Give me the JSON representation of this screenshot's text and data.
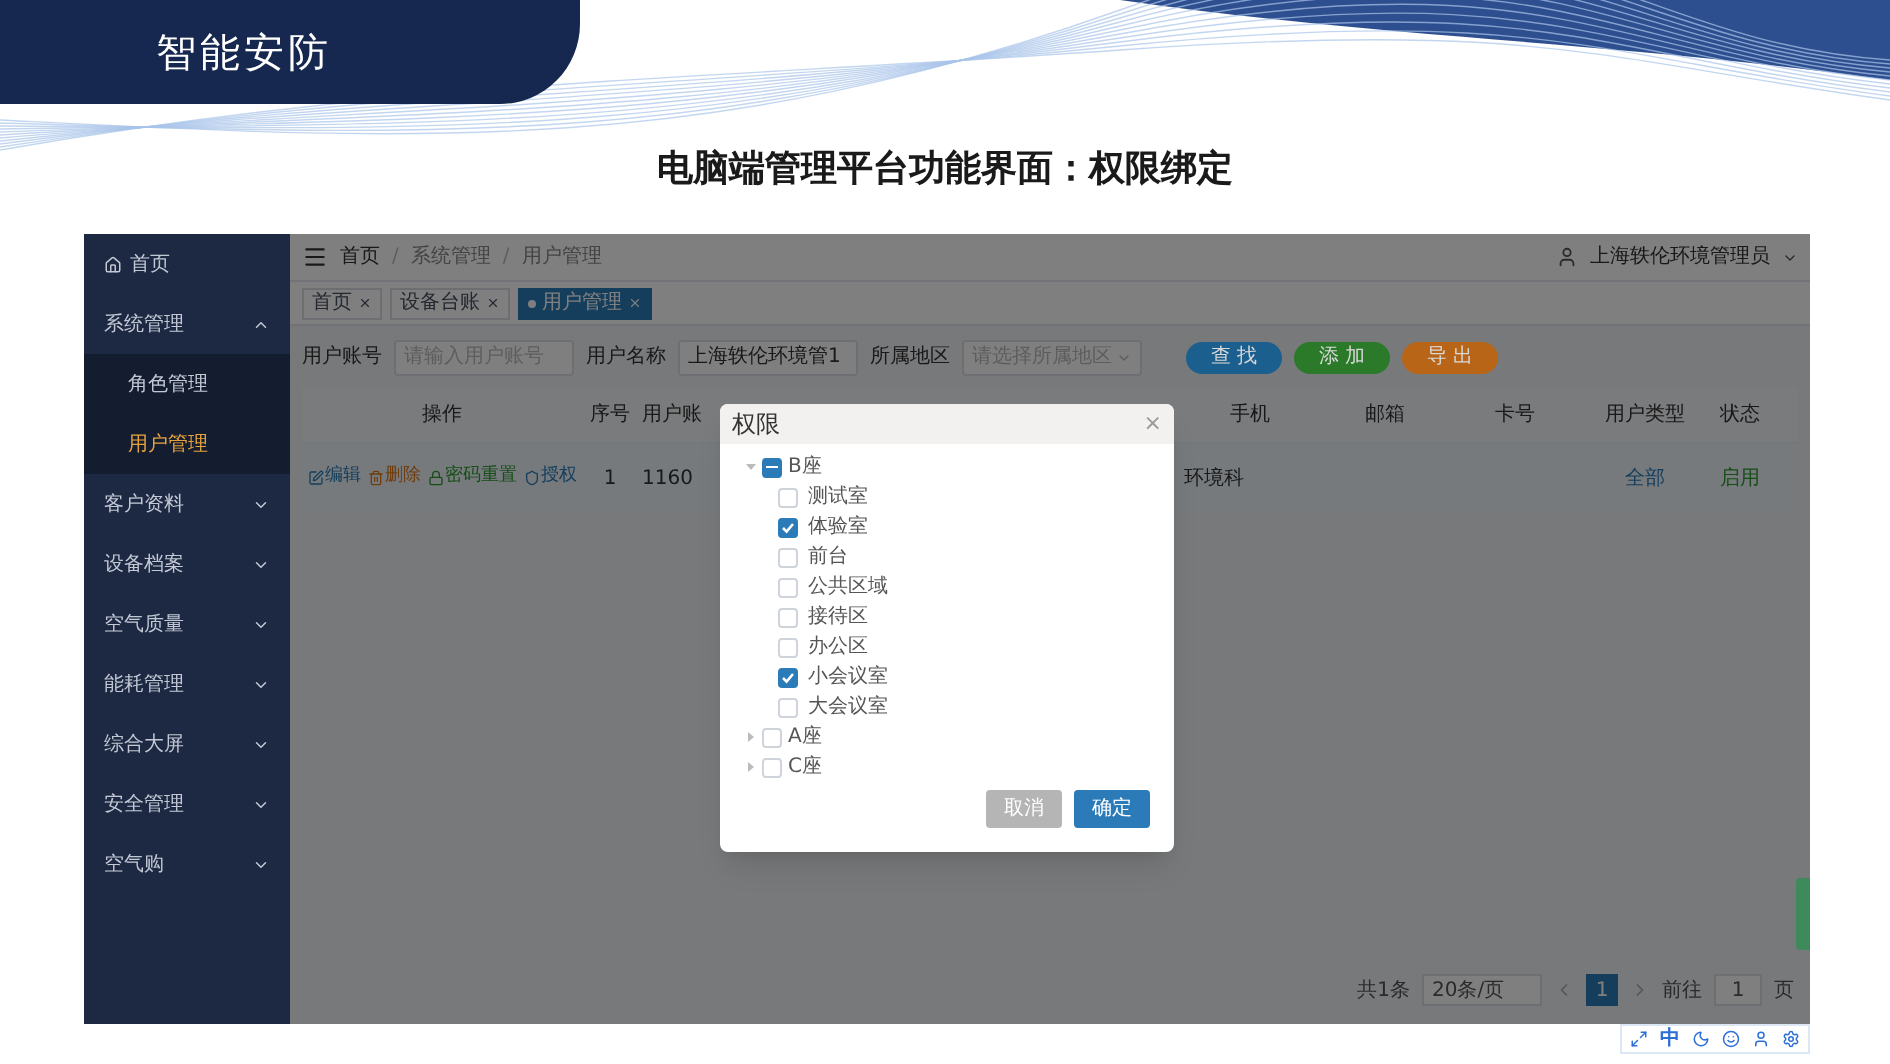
{
  "slide": {
    "section_title": "智能安防",
    "heading": "电脑端管理平台功能界面：权限绑定"
  },
  "sidebar": {
    "items": [
      {
        "label": "首页",
        "kind": "home",
        "selected": false
      },
      {
        "label": "系统管理",
        "kind": "group",
        "expanded": true,
        "selected": false,
        "children": [
          {
            "label": "角色管理",
            "selected": false
          },
          {
            "label": "用户管理",
            "selected": true
          }
        ]
      },
      {
        "label": "客户资料",
        "kind": "group",
        "expanded": false,
        "selected": false
      },
      {
        "label": "设备档案",
        "kind": "group",
        "expanded": false,
        "selected": false
      },
      {
        "label": "空气质量",
        "kind": "group",
        "expanded": false,
        "selected": false
      },
      {
        "label": "能耗管理",
        "kind": "group",
        "expanded": false,
        "selected": false
      },
      {
        "label": "综合大屏",
        "kind": "group",
        "expanded": false,
        "selected": false
      },
      {
        "label": "安全管理",
        "kind": "group",
        "expanded": false,
        "selected": false
      },
      {
        "label": "空气购",
        "kind": "group",
        "expanded": false,
        "selected": false
      }
    ]
  },
  "breadcrumb": {
    "items": [
      "首页",
      "系统管理",
      "用户管理"
    ],
    "separators": [
      "/",
      "/"
    ]
  },
  "user": {
    "name": "上海轶伦环境管理员"
  },
  "tabs": [
    {
      "label": "首页",
      "selected": false
    },
    {
      "label": "设备台账",
      "selected": false
    },
    {
      "label": "用户管理",
      "selected": true
    }
  ],
  "filters": [
    {
      "label": "用户账号",
      "placeholder": "请输入用户账号",
      "kind": "input"
    },
    {
      "label": "用户名称",
      "value": "上海轶伦环境管1",
      "kind": "input"
    },
    {
      "label": "所属地区",
      "placeholder": "请选择所属地区",
      "kind": "select"
    }
  ],
  "actions": [
    {
      "label": "查 找",
      "color": "#1b5f8e"
    },
    {
      "label": "添 加",
      "color": "#2a7a2a"
    },
    {
      "label": "导 出",
      "color": "#b86518"
    }
  ],
  "table": {
    "columns": [
      "操作",
      "序号",
      "用户账",
      "手机",
      "邮箱",
      "卡号",
      "用户类型",
      "状态"
    ],
    "rows": [
      {
        "actions": [
          {
            "label": "编辑",
            "kind": "edit"
          },
          {
            "label": "删除",
            "kind": "delete"
          },
          {
            "label": "密码重置",
            "kind": "reset"
          },
          {
            "label": "授权",
            "kind": "grant"
          }
        ],
        "index": "1",
        "account": "1160",
        "column_4": "环境科",
        "user_type": "全部",
        "status": "启用"
      }
    ]
  },
  "pagination": {
    "total": "共1条",
    "page_size": "20条/页",
    "pages": [
      {
        "label": "1",
        "selected": true
      }
    ],
    "goto_label": "前往",
    "goto_value": "1",
    "goto_unit": "页"
  },
  "dialog": {
    "title": "权限",
    "close": "×",
    "tree": [
      {
        "label": "B座",
        "expanded": true,
        "checked": false,
        "indeterminate": true,
        "children": [
          {
            "label": "测试室",
            "checked": false
          },
          {
            "label": "体验室",
            "checked": true
          },
          {
            "label": "前台",
            "checked": false
          },
          {
            "label": "公共区域",
            "checked": false
          },
          {
            "label": "接待区",
            "checked": false
          },
          {
            "label": "办公区",
            "checked": false
          },
          {
            "label": "小会议室",
            "checked": true
          },
          {
            "label": "大会议室",
            "checked": false
          }
        ]
      },
      {
        "label": "A座",
        "expanded": false,
        "checked": false,
        "indeterminate": false
      },
      {
        "label": "C座",
        "expanded": false,
        "checked": false,
        "indeterminate": false
      }
    ],
    "buttons": [
      {
        "label": "取消",
        "kind": "secondary"
      },
      {
        "label": "确定",
        "kind": "primary"
      }
    ]
  },
  "ime_toolbar": {
    "language": "中"
  }
}
